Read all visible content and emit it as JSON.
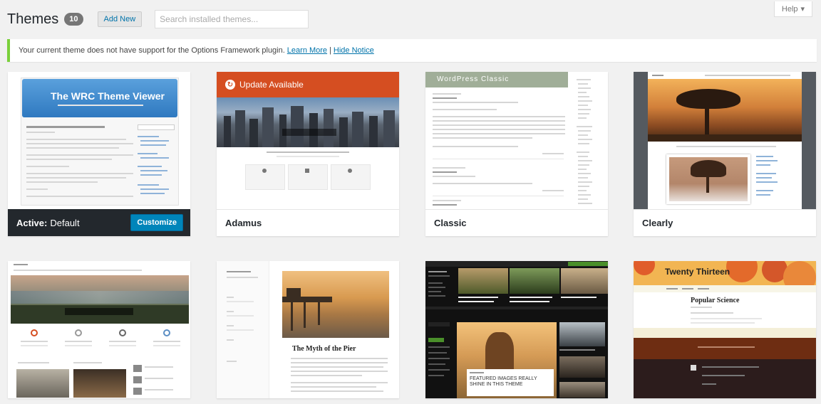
{
  "header": {
    "title": "Themes",
    "count": "10",
    "add_new_label": "Add New",
    "search_placeholder": "Search installed themes...",
    "help_label": "Help"
  },
  "notice": {
    "text": "Your current theme does not have support for the Options Framework plugin.",
    "learn_more": "Learn More",
    "separator": "|",
    "hide_notice": "Hide Notice"
  },
  "themes": [
    {
      "name": "Default",
      "active": true,
      "active_label": "Active:",
      "action_label": "Customize",
      "preview_title": "The WRC Theme Viewer"
    },
    {
      "name": "Adamus",
      "update_label": "Update Available"
    },
    {
      "name": "Classic",
      "preview_title": "WordPress Classic"
    },
    {
      "name": "Clearly"
    },
    {
      "name": ""
    },
    {
      "name": "",
      "preview_heading": "The Myth of the Pier"
    },
    {
      "name": "",
      "preview_caption": "FEATURED IMAGES REALLY SHINE IN THIS THEME"
    },
    {
      "name": "",
      "preview_title": "Twenty Thirteen",
      "preview_heading": "Popular Science"
    }
  ],
  "colors": {
    "accent": "#0073aa",
    "primary_button": "#0085ba",
    "notice_border": "#7ad03a",
    "active_bar": "#23282d",
    "update_banner": "#d54e21"
  }
}
